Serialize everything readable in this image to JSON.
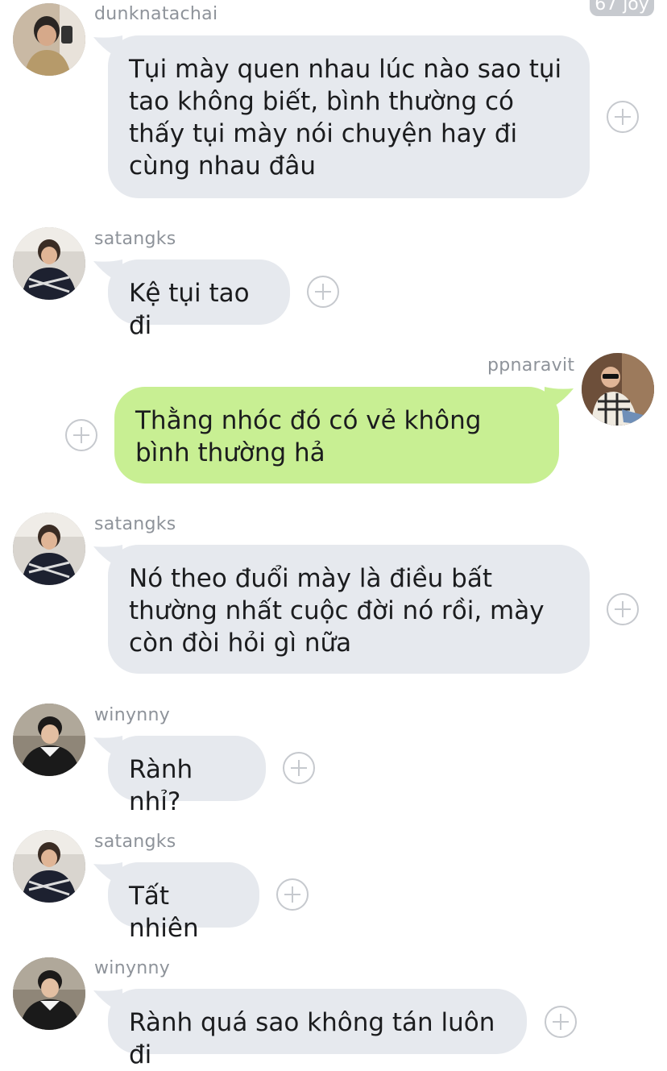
{
  "top_badge": "67 joy",
  "messages": [
    {
      "user": "dunknatachai",
      "text": "Tụi mày quen nhau lúc nào sao tụi tao không biết, bình thường có thấy tụi mày nói chuyện hay đi cùng nhau đâu",
      "direction": "incoming"
    },
    {
      "user": "satangks",
      "text": "Kệ tụi tao đi",
      "direction": "incoming"
    },
    {
      "user": "ppnaravit",
      "text": "Thằng nhóc đó có vẻ không bình thường hả",
      "direction": "outgoing"
    },
    {
      "user": "satangks",
      "text": "Nó theo đuổi mày là điều bất thường nhất cuộc đời nó rồi, mày còn đòi hỏi gì nữa",
      "direction": "incoming"
    },
    {
      "user": "winynny",
      "text": "Rành nhỉ?",
      "direction": "incoming"
    },
    {
      "user": "satangks",
      "text": "Tất nhiên",
      "direction": "incoming"
    },
    {
      "user": "winynny",
      "text": "Rành quá sao không tán luôn đi",
      "direction": "incoming"
    }
  ],
  "colors": {
    "incoming_bubble": "#e6e9ee",
    "outgoing_bubble": "#c8ef93",
    "username": "#8e939a",
    "plus_icon": "#c6c9ce"
  },
  "icons": {
    "reaction_button": "plus-circle-icon",
    "avatar": "user-avatar"
  }
}
